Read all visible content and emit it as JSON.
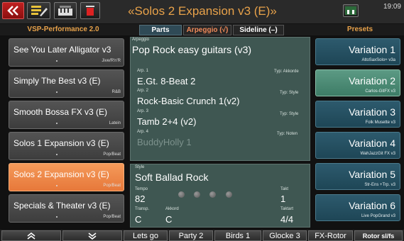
{
  "header": {
    "title": "«Solos 2 Expansion v3 (E)»",
    "clock": "19:09",
    "left_label": "VSP-Performance 2.0",
    "presets_label": "Presets"
  },
  "tabs": [
    {
      "label": "Parts",
      "color": "#ffffff"
    },
    {
      "label": "Arpeggio (√)",
      "color": "#f08a5a"
    },
    {
      "label": "Sideline (–)",
      "color": "#ffffff"
    }
  ],
  "styles_list": [
    {
      "name": "See You Later Alligator v3",
      "genre": "Jive/R'n'R"
    },
    {
      "name": "Simply The Best v3 (E)",
      "genre": "R&B"
    },
    {
      "name": "Smooth Bossa FX v3 (E)",
      "genre": "Latein"
    },
    {
      "name": "Solos 1 Expansion v3 (E)",
      "genre": "Pop/Beat"
    },
    {
      "name": "Solos 2 Expansion v3 (E)",
      "genre": "Pop/Beat"
    },
    {
      "name": "Specials & Theater v3 (E)",
      "genre": "Pop/Beat"
    }
  ],
  "arpeggio": {
    "label": "Arpeggio",
    "name": "Pop Rock easy guitars (v3)",
    "arps": [
      {
        "label": "Arp. 1",
        "value": "E.Gt. 8-Beat 2",
        "type": "Typ: Akkorde"
      },
      {
        "label": "Arp. 2",
        "value": "Rock-Basic Crunch 1(v2)",
        "type": "Typ: Style"
      },
      {
        "label": "Arp. 3",
        "value": "Tamb 2+4 (v2)",
        "type": "Typ: Style"
      },
      {
        "label": "Arp. 4",
        "value": "BuddyHolly 1",
        "type": "Typ: Noten"
      }
    ]
  },
  "style": {
    "label": "Style",
    "name": "Soft Ballad Rock",
    "tempo_label": "Tempo",
    "tempo": "82",
    "takt_label": "Takt",
    "takt": "1",
    "transp_label": "Transp.",
    "transp": "C",
    "akkord_label": "Akkord",
    "akkord": "C",
    "taktart_label": "Taktart",
    "taktart": "4/4"
  },
  "variations": [
    {
      "name": "Variation 1",
      "sub": "AltoSaxSolo+ v3a"
    },
    {
      "name": "Variation 2",
      "sub": "Carlos-GitFX v3"
    },
    {
      "name": "Variation 3",
      "sub": "Folk Musette v3"
    },
    {
      "name": "Variation 4",
      "sub": "WahJazzGit FX v3"
    },
    {
      "name": "Variation 5",
      "sub": "Str-Ens +Trp. v3"
    },
    {
      "name": "Variation 6",
      "sub": "Live PopGrand v3"
    }
  ],
  "bottom": {
    "scroll_up": "⌃",
    "scroll_down": "⌄",
    "buttons": [
      "Lets go",
      "Party 2",
      "Birds 1",
      "Glocke 3",
      "FX-Rotor",
      "Rotor sl/fs"
    ]
  }
}
